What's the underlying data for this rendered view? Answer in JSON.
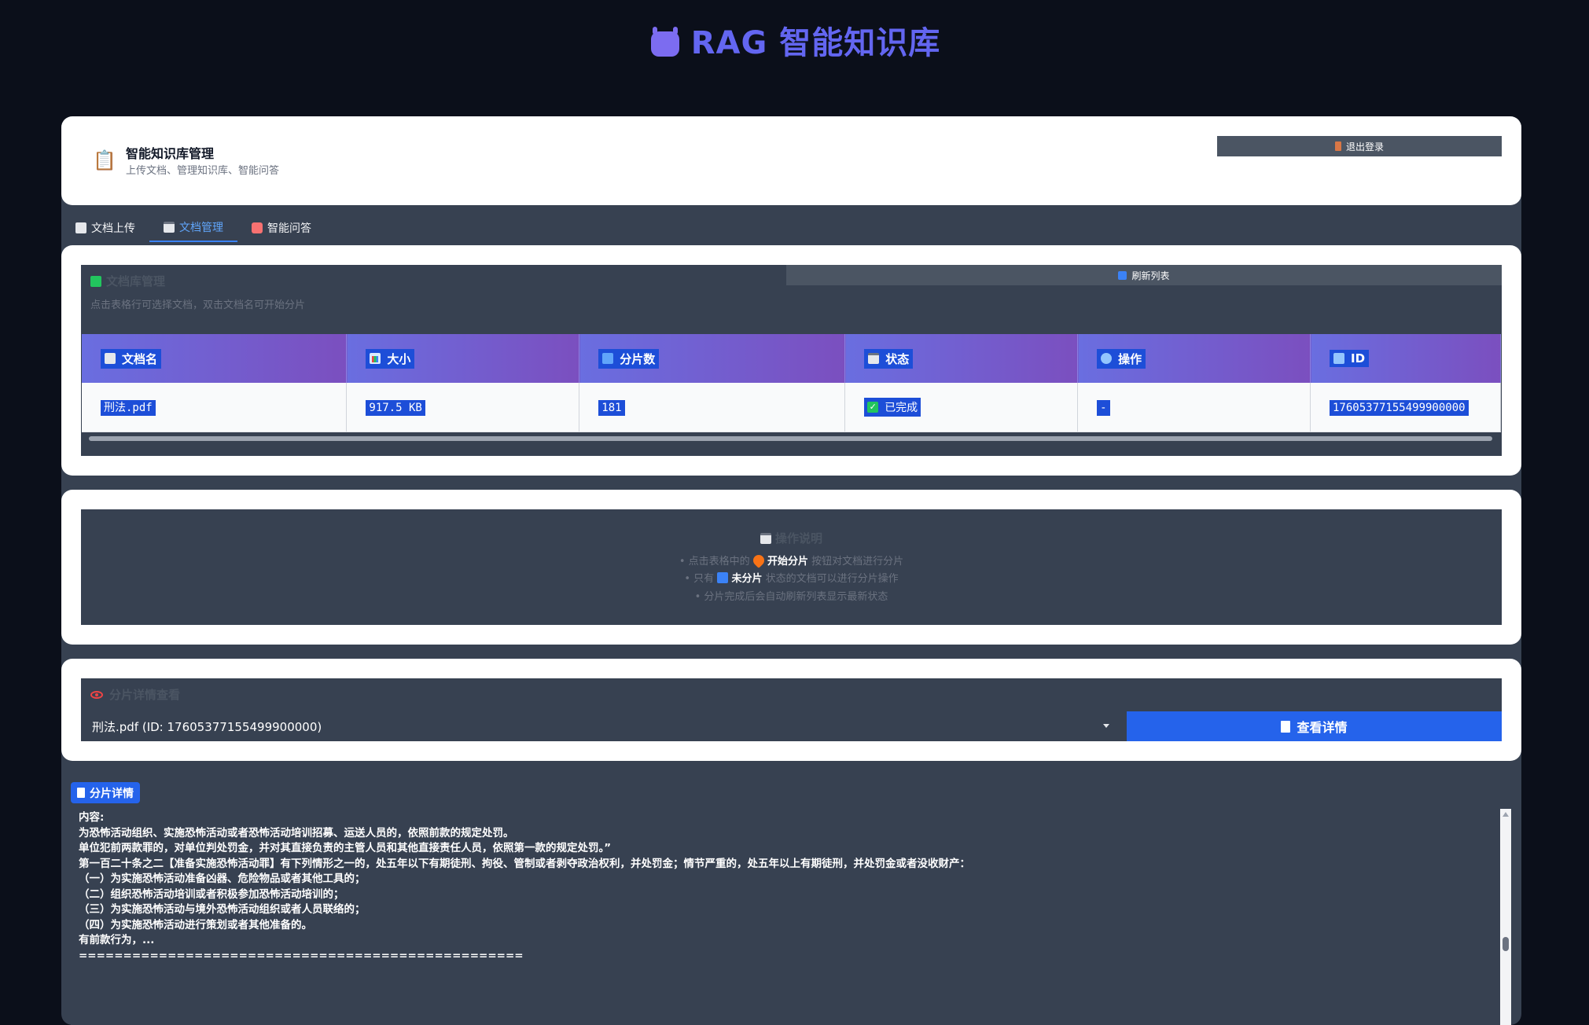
{
  "app": {
    "title": "RAG 智能知识库"
  },
  "header": {
    "title": "智能知识库管理",
    "subtitle": "上传文档、管理知识库、智能问答",
    "logout_label": "退出登录"
  },
  "tabs": [
    {
      "label": "文档上传",
      "active": false
    },
    {
      "label": "文档管理",
      "active": true
    },
    {
      "label": "智能问答",
      "active": false
    }
  ],
  "library": {
    "title": "文档库管理",
    "subtitle": "点击表格行可选择文档，双击文档名可开始分片",
    "refresh_label": "刷新列表",
    "columns": [
      "文档名",
      "大小",
      "分片数",
      "状态",
      "操作",
      "ID"
    ],
    "rows": [
      {
        "name": "刑法.pdf",
        "size": "917.5 KB",
        "chunks": "181",
        "status": "已完成",
        "action": "-",
        "id": "17605377155499900000"
      }
    ]
  },
  "instructions": {
    "title": "操作说明",
    "line1_pre": "点击表格中的",
    "line1_bold": "开始分片",
    "line1_post": "按钮对文档进行分片",
    "line2_pre": "只有",
    "line2_bold": "未分片",
    "line2_post": "状态的文档可以进行分片操作",
    "line3": "分片完成后会自动刷新列表显示最新状态"
  },
  "chunk_viewer": {
    "title": "分片详情查看",
    "selected": "刑法.pdf (ID: 17605377155499900000)",
    "view_label": "查看详情"
  },
  "chunk_detail": {
    "badge": "分片详情",
    "lines": [
      "内容:",
      "为恐怖活动组织、实施恐怖活动或者恐怖活动培训招募、运送人员的，依照前款的规定处罚。",
      "",
      "单位犯前两款罪的，对单位判处罚金，并对其直接负责的主管人员和其他直接责任人员，依照第一款的规定处罚。”",
      "",
      "第一百二十条之二【准备实施恐怖活动罪】有下列情形之一的，处五年以下有期徒刑、拘役、管制或者剥夺政治权利，并处罚金；情节严重的，处五年以上有期徒刑，并处罚金或者没收财产：",
      "",
      "（一）为实施恐怖活动准备凶器、危险物品或者其他工具的；",
      "（二）组织恐怖活动培训或者积极参加恐怖活动培训的；",
      "（三）为实施恐怖活动与境外恐怖活动组织或者人员联络的；",
      "（四）为实施恐怖活动进行策划或者其他准备的。",
      "",
      "有前款行为，...",
      "=================================================="
    ]
  },
  "colors": {
    "accent": "#6366f1",
    "primary_button": "#2563eb",
    "success": "#22c55e"
  }
}
